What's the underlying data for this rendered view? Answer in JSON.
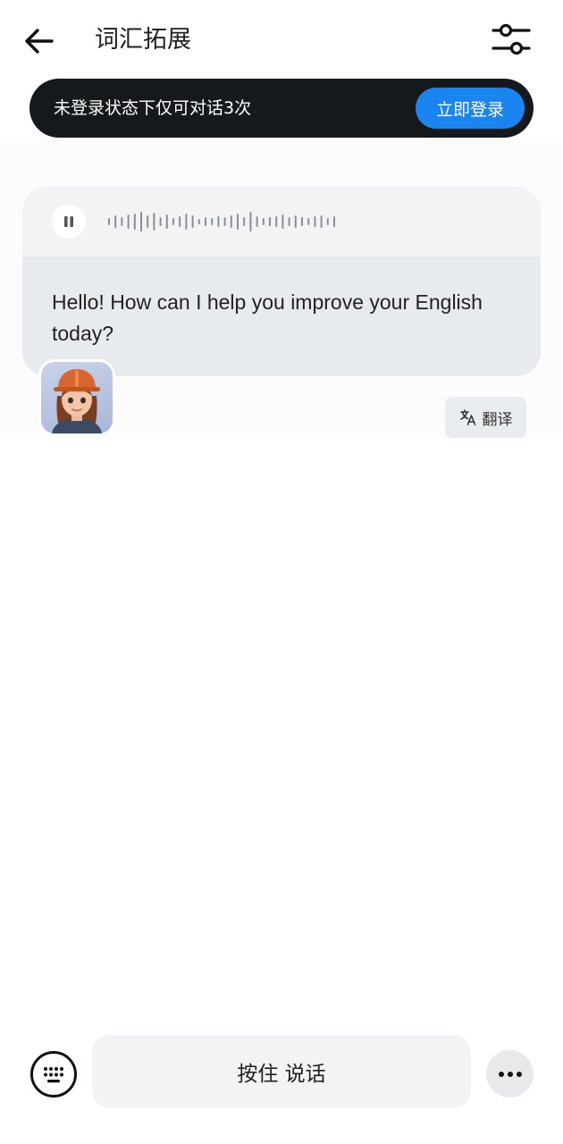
{
  "header": {
    "title": "词汇拓展",
    "back_icon": "arrow-left-icon",
    "settings_icon": "sliders-icon"
  },
  "banner": {
    "text": "未登录状态下仅可对话3次",
    "login_label": "立即登录"
  },
  "message": {
    "text": "Hello! How can I help you improve your English today?",
    "audio_state": "playing",
    "pause_icon": "pause-icon",
    "translate_label": "翻译",
    "translate_icon": "translate-icon"
  },
  "input_bar": {
    "hold_to_talk_label": "按住 说话",
    "keyboard_icon": "keyboard-icon",
    "more_icon": "more-dots-icon"
  },
  "colors": {
    "accent": "#1a84f0",
    "banner_bg": "#16191c",
    "bubble_bg": "#e7eaee"
  }
}
